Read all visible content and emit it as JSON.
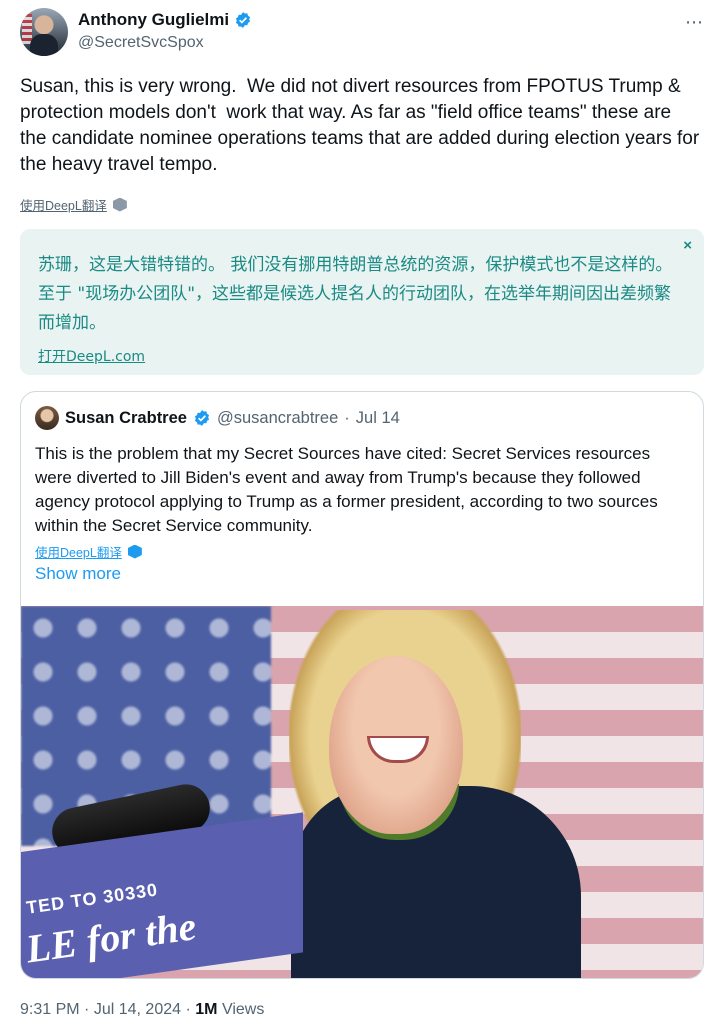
{
  "author": {
    "display_name": "Anthony Guglielmi",
    "handle": "@SecretSvcSpox",
    "verified": true,
    "more_icon": "⋯"
  },
  "tweet": {
    "text": "Susan, this is very wrong.  We did not divert resources from FPOTUS Trump & protection models don't  work that way. As far as \"field office teams\" these are the candidate nominee operations teams that are added during election years for the heavy travel tempo.",
    "translate_label": "使用DeepL翻译"
  },
  "translation": {
    "text": "苏珊，这是大错特错的。 我们没有挪用特朗普总统的资源，保护模式也不是这样的。 至于 \"现场办公团队\"，这些都是候选人提名人的行动团队，在选举年期间因出差频繁而增加。",
    "close": "×",
    "open_link": "打开DeepL.com"
  },
  "quote": {
    "display_name": "Susan Crabtree",
    "handle": "@susancrabtree",
    "separator": "·",
    "date": "Jul 14",
    "text": "This is the problem that my Secret Sources have cited: Secret Services resources were diverted to Jill Biden's event and away from Trump's because they followed agency protocol applying to Trump as a former president, according to two sources within the Secret Service community.",
    "translate_label": "使用DeepL翻译",
    "show_more": "Show more",
    "image_sign_line1": "TED TO 30330",
    "image_sign_line2": "LE for the"
  },
  "footer": {
    "time": "9:31 PM",
    "sep1": "·",
    "date": "Jul 14, 2024",
    "sep2": "·",
    "views_count": "1M",
    "views_label": "Views"
  },
  "colors": {
    "verified_blue": "#1d9bf0",
    "link_blue": "#1d9bf0",
    "translation_bg": "#e8f3f2",
    "translation_text": "#1b8a84"
  }
}
